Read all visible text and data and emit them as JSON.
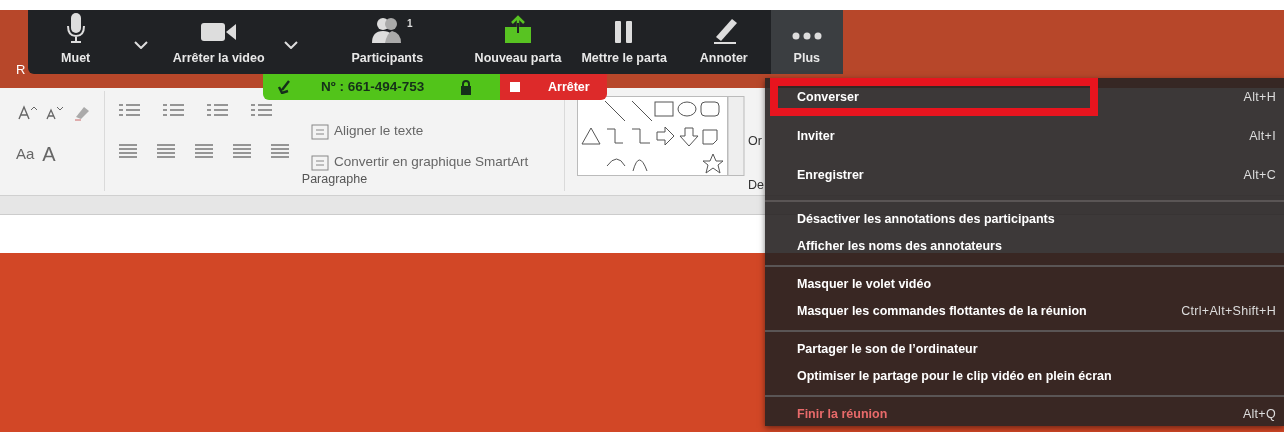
{
  "app_title": "R",
  "toolbar": [
    {
      "kind": "mic",
      "label": "Muet",
      "caret": true,
      "selected": false
    },
    {
      "kind": "camera",
      "label": "Arrêter la video",
      "caret": true,
      "selected": false
    },
    {
      "kind": "people",
      "label": "Participants",
      "count": "1",
      "caret": false,
      "selected": false
    },
    {
      "kind": "share",
      "label": "Nouveau parta",
      "caret": false,
      "selected": false
    },
    {
      "kind": "pause",
      "label": "Mettre le parta",
      "caret": false,
      "selected": false
    },
    {
      "kind": "pencil",
      "label": "Annoter",
      "caret": false,
      "selected": false
    },
    {
      "kind": "dots",
      "label": "Plus",
      "caret": false,
      "selected": true
    }
  ],
  "meeting_bar": {
    "meeting_id": "Nº : 661-494-753",
    "stop_label": "Arrêter"
  },
  "ribbon": {
    "font_row2": [
      "Aa",
      "A"
    ],
    "paragraph_commands": [
      "Aligner le texte",
      "Convertir en graphique SmartArt"
    ],
    "group_label": "Paragraphe",
    "cut_labels": [
      "Or",
      "De"
    ]
  },
  "menu": [
    {
      "label": "Converser",
      "shortcut": "Alt+H",
      "highlighted": true,
      "kind": "item",
      "separator_after": false
    },
    {
      "label": "Inviter",
      "shortcut": "Alt+I",
      "highlighted": false,
      "kind": "item",
      "separator_after": false
    },
    {
      "label": "Enregistrer",
      "shortcut": "Alt+C",
      "highlighted": false,
      "kind": "item",
      "separator_after": true
    },
    {
      "label": "Désactiver les annotations des participants",
      "highlighted": false,
      "kind": "item",
      "separator_after": false
    },
    {
      "label": "Afficher les noms des annotateurs",
      "highlighted": false,
      "kind": "item",
      "separator_after": true
    },
    {
      "label": "Masquer le volet vidéo",
      "highlighted": false,
      "kind": "item",
      "separator_after": false
    },
    {
      "label": "Masquer les commandes flottantes de la réunion",
      "shortcut": "Ctrl+Alt+Shift+H",
      "highlighted": false,
      "kind": "item",
      "separator_after": true
    },
    {
      "label": "Partager le son de l’ordinateur",
      "highlighted": false,
      "kind": "item",
      "separator_after": false
    },
    {
      "label": "Optimiser le partage pour le clip vidéo en plein écran",
      "highlighted": false,
      "kind": "item",
      "separator_after": true
    },
    {
      "label": "Finir la réunion",
      "shortcut": "Alt+Q",
      "highlighted": false,
      "kind": "danger",
      "separator_after": false
    }
  ]
}
